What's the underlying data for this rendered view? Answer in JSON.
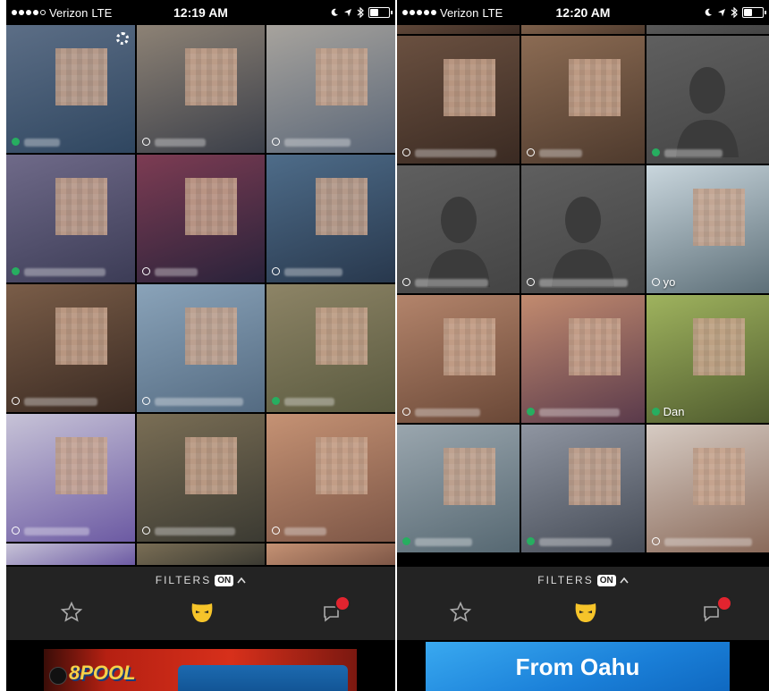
{
  "left_screen": {
    "status_bar": {
      "carrier": "Verizon",
      "network": "LTE",
      "time": "12:19 AM"
    },
    "filters": {
      "label": "FILTERS",
      "badge": "ON"
    },
    "tiles": [
      {
        "color_a": "#5c6e86",
        "color_b": "#2f4660",
        "online": true,
        "name": ""
      },
      {
        "color_a": "#8d8275",
        "color_b": "#3b3f49",
        "online": false,
        "name": ""
      },
      {
        "color_a": "#a7a39d",
        "color_b": "#5b6778",
        "online": false,
        "name": ""
      },
      {
        "color_a": "#6f6a89",
        "color_b": "#3c3c56",
        "online": true,
        "name": ""
      },
      {
        "color_a": "#7d3c53",
        "color_b": "#29223a",
        "online": false,
        "name": ""
      },
      {
        "color_a": "#4e6c89",
        "color_b": "#28384d",
        "online": false,
        "name": ""
      },
      {
        "color_a": "#7a5d48",
        "color_b": "#3a2a22",
        "online": false,
        "name": ""
      },
      {
        "color_a": "#8aa3b9",
        "color_b": "#546b82",
        "online": false,
        "name": ""
      },
      {
        "color_a": "#8d8466",
        "color_b": "#5a5a3f",
        "online": true,
        "name": ""
      },
      {
        "color_a": "#c7c3d7",
        "color_b": "#6c5aa3",
        "online": false,
        "name": ""
      },
      {
        "color_a": "#7a6e55",
        "color_b": "#3b3a32",
        "online": false,
        "name": ""
      },
      {
        "color_a": "#c59274",
        "color_b": "#7d5646",
        "online": false,
        "name": ""
      }
    ],
    "ad": {
      "brand": "8POOL"
    }
  },
  "right_screen": {
    "status_bar": {
      "carrier": "Verizon",
      "network": "LTE",
      "time": "12:20 AM"
    },
    "filters": {
      "label": "FILTERS",
      "badge": "ON"
    },
    "tiles": [
      {
        "color_a": "#6a5040",
        "color_b": "#3a2a22",
        "online": false,
        "name": ""
      },
      {
        "color_a": "#8b6b53",
        "color_b": "#4e3a2d",
        "online": false,
        "name": ""
      },
      {
        "color_a": "#5f5f5f",
        "color_b": "#444444",
        "online": true,
        "name": "",
        "silhouette": true
      },
      {
        "color_a": "#5f5f5f",
        "color_b": "#444444",
        "online": false,
        "name": "",
        "silhouette": true
      },
      {
        "color_a": "#5f5f5f",
        "color_b": "#444444",
        "online": false,
        "name": "",
        "silhouette": true
      },
      {
        "color_a": "#c9d6dd",
        "color_b": "#5d6f78",
        "online": false,
        "name": "yo"
      },
      {
        "color_a": "#b3846b",
        "color_b": "#6a4837",
        "online": false,
        "name": ""
      },
      {
        "color_a": "#c28b6f",
        "color_b": "#5a3a4b",
        "online": true,
        "name": ""
      },
      {
        "color_a": "#9fb35e",
        "color_b": "#4f5b2e",
        "online": true,
        "name": "Dan"
      },
      {
        "color_a": "#9aa6ae",
        "color_b": "#566872",
        "online": true,
        "name": ""
      },
      {
        "color_a": "#8f95a1",
        "color_b": "#454b56",
        "online": true,
        "name": ""
      },
      {
        "color_a": "#d6cbc3",
        "color_b": "#8a6a5a",
        "online": false,
        "name": ""
      }
    ],
    "ad": {
      "headline": "From Oahu"
    }
  },
  "colors": {
    "online": "#27ae60",
    "grindr_yellow": "#f6c42a",
    "chat_badge": "#e2242f"
  }
}
